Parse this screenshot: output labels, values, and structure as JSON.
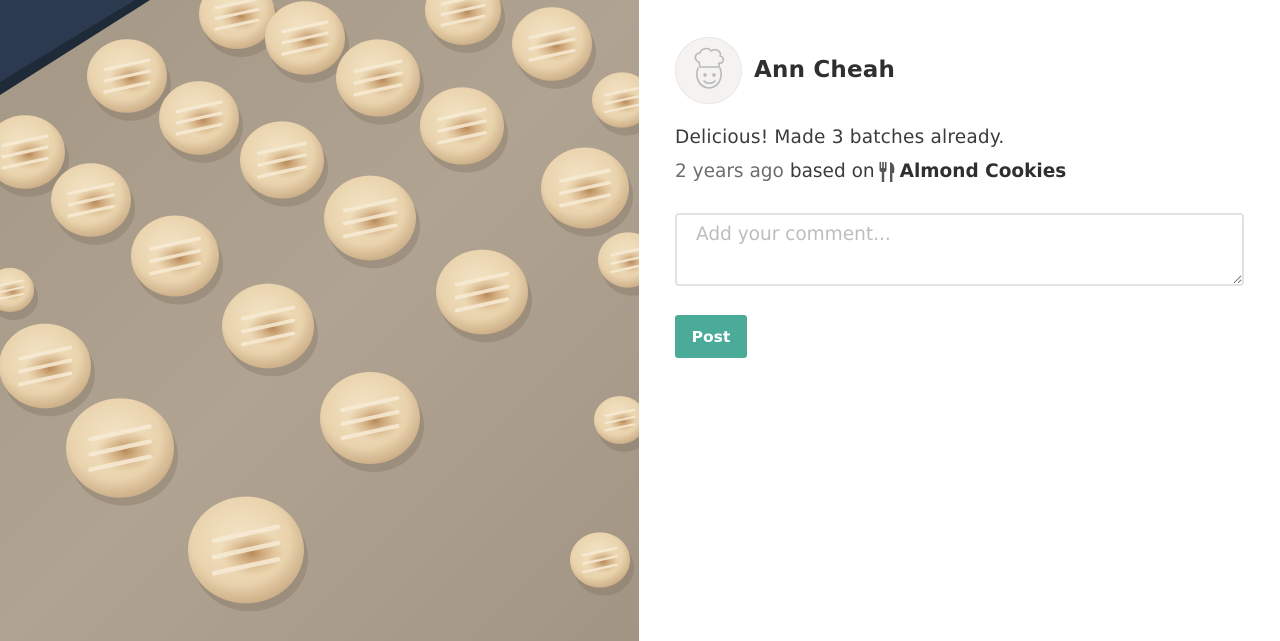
{
  "photo": {
    "alt_icon": "cookies-photo"
  },
  "author": {
    "name": "Ann Cheah",
    "avatar_icon": "chef-avatar-icon"
  },
  "comment": {
    "text": "Delicious! Made 3 batches already.",
    "time": "2 years ago",
    "based_on": "based on",
    "recipe_icon": "utensils-icon",
    "recipe_name": "Almond Cookies"
  },
  "reply": {
    "placeholder": "Add your comment...",
    "post_label": "Post"
  },
  "colors": {
    "accent": "#4aab98",
    "text": "#333333",
    "muted": "#6d6d6d",
    "placeholder": "#bdbdbd"
  }
}
